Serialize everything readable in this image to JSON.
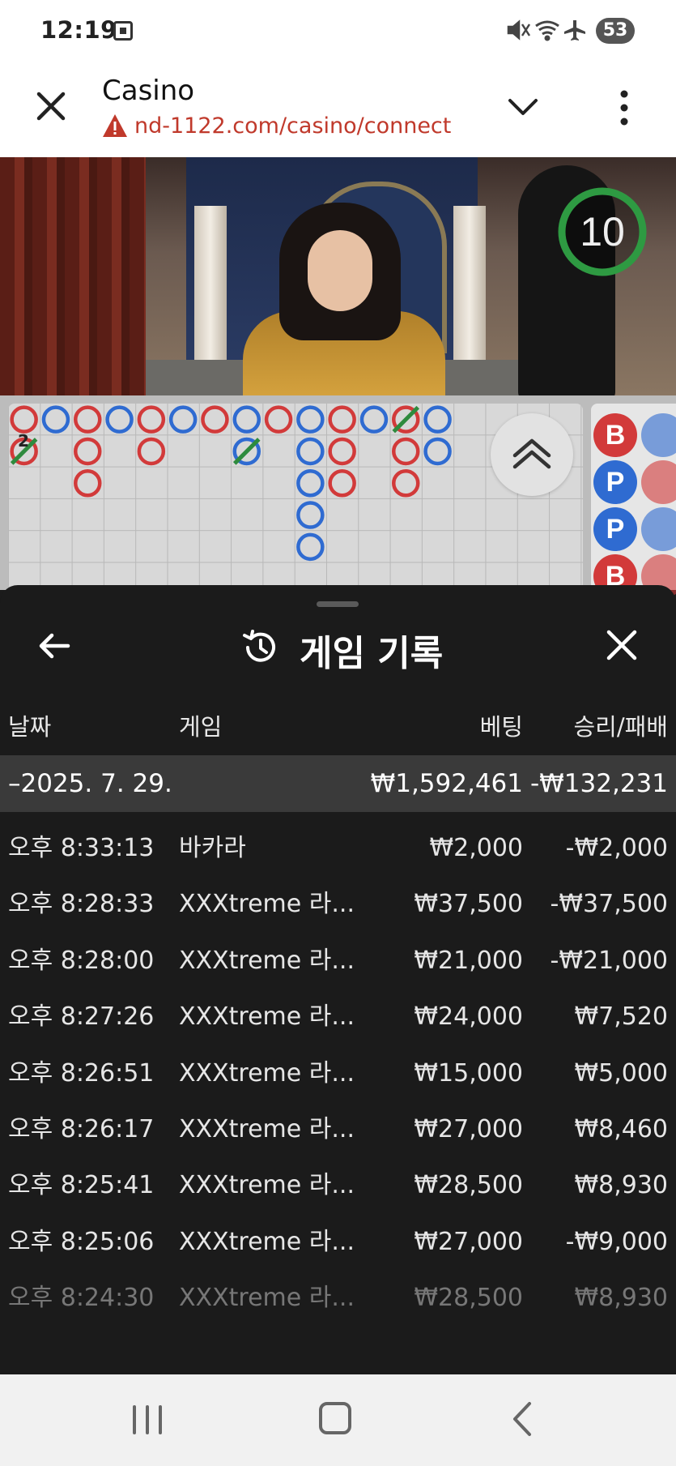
{
  "status_bar": {
    "time": "12:19",
    "battery": "53",
    "icons": [
      "screenshot-icon",
      "mute-icon",
      "wifi-icon",
      "airplane-icon"
    ]
  },
  "browser": {
    "title": "Casino",
    "url": "nd-1122.com/casino/connect",
    "url_color": "#c0392b"
  },
  "video": {
    "timer": "10"
  },
  "roadmap": {
    "tie_count": "2",
    "bead_labels": [
      "B",
      "P",
      "P",
      "B"
    ],
    "colors": {
      "banker": "#d23a3a",
      "player": "#2f6bd1",
      "tie": "#2e8b3e"
    }
  },
  "sheet": {
    "title": "게임 기록",
    "columns": {
      "date": "날짜",
      "game": "게임",
      "bet": "베팅",
      "result": "승리/패배"
    },
    "group": {
      "date": "–2025. 7. 29.",
      "bet_total": "₩1,592,461",
      "result_total": "-₩132,231"
    },
    "rows": [
      {
        "time": "오후 8:33:13",
        "game": "바카라",
        "bet": "₩2,000",
        "result": "-₩2,000"
      },
      {
        "time": "오후 8:28:33",
        "game": "XXXtreme 라...",
        "bet": "₩37,500",
        "result": "-₩37,500"
      },
      {
        "time": "오후 8:28:00",
        "game": "XXXtreme 라...",
        "bet": "₩21,000",
        "result": "-₩21,000"
      },
      {
        "time": "오후 8:27:26",
        "game": "XXXtreme 라...",
        "bet": "₩24,000",
        "result": "₩7,520"
      },
      {
        "time": "오후 8:26:51",
        "game": "XXXtreme 라...",
        "bet": "₩15,000",
        "result": "₩5,000"
      },
      {
        "time": "오후 8:26:17",
        "game": "XXXtreme 라...",
        "bet": "₩27,000",
        "result": "₩8,460"
      },
      {
        "time": "오후 8:25:41",
        "game": "XXXtreme 라...",
        "bet": "₩28,500",
        "result": "₩8,930"
      },
      {
        "time": "오후 8:25:06",
        "game": "XXXtreme 라...",
        "bet": "₩27,000",
        "result": "-₩9,000"
      },
      {
        "time": "오후 8:24:30",
        "game": "XXXtreme 라...",
        "bet": "₩28,500",
        "result": "₩8,930"
      }
    ]
  },
  "nav": {
    "buttons": [
      "recent-apps-icon",
      "home-icon",
      "back-icon"
    ]
  }
}
